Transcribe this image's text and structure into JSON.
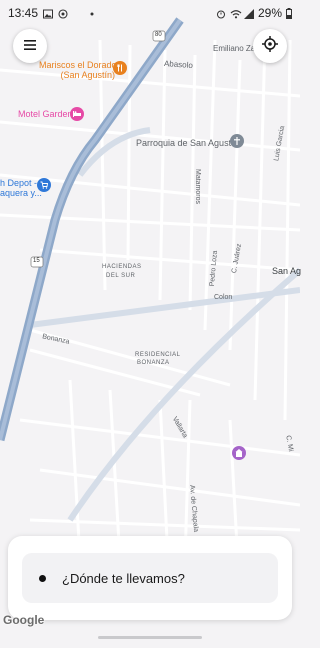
{
  "status_bar": {
    "time": "13:45",
    "battery": "29%"
  },
  "map": {
    "streets": [
      "Emiliano Zapata",
      "Abasolo",
      "Parroquia de San Agustín",
      "Matamoros",
      "Luis Garcia",
      "HACIENDAS",
      "DEL SUR",
      "Pedro Loza",
      "C. Juárez",
      "San Ag",
      "Colon",
      "Bonanza",
      "RESIDENCIAL",
      "BONANZA",
      "Vallarta",
      "C. Mi",
      "Av. de Chapala"
    ],
    "highway_shield": "80",
    "highway_shield_2": "15",
    "pois": [
      {
        "name": "Mariscos el Dorado",
        "sub": "(San Agustín)",
        "color": "#e8811f"
      },
      {
        "name": "Motel Garden",
        "sub": "",
        "color": "#e64aa6"
      },
      {
        "name": "h Depot -",
        "sub": "aquera y...",
        "color": "#2f78d8"
      }
    ]
  },
  "controls": {
    "menu_icon": "menu-icon",
    "locate_icon": "crosshair-icon"
  },
  "search": {
    "placeholder": "¿Dónde te llevamos?"
  },
  "attribution": "Google",
  "colors": {
    "map_bg": "#f4f3f5",
    "highway": "#8ea8c9",
    "road": "#ffffff",
    "text": "#1a1a1a"
  }
}
